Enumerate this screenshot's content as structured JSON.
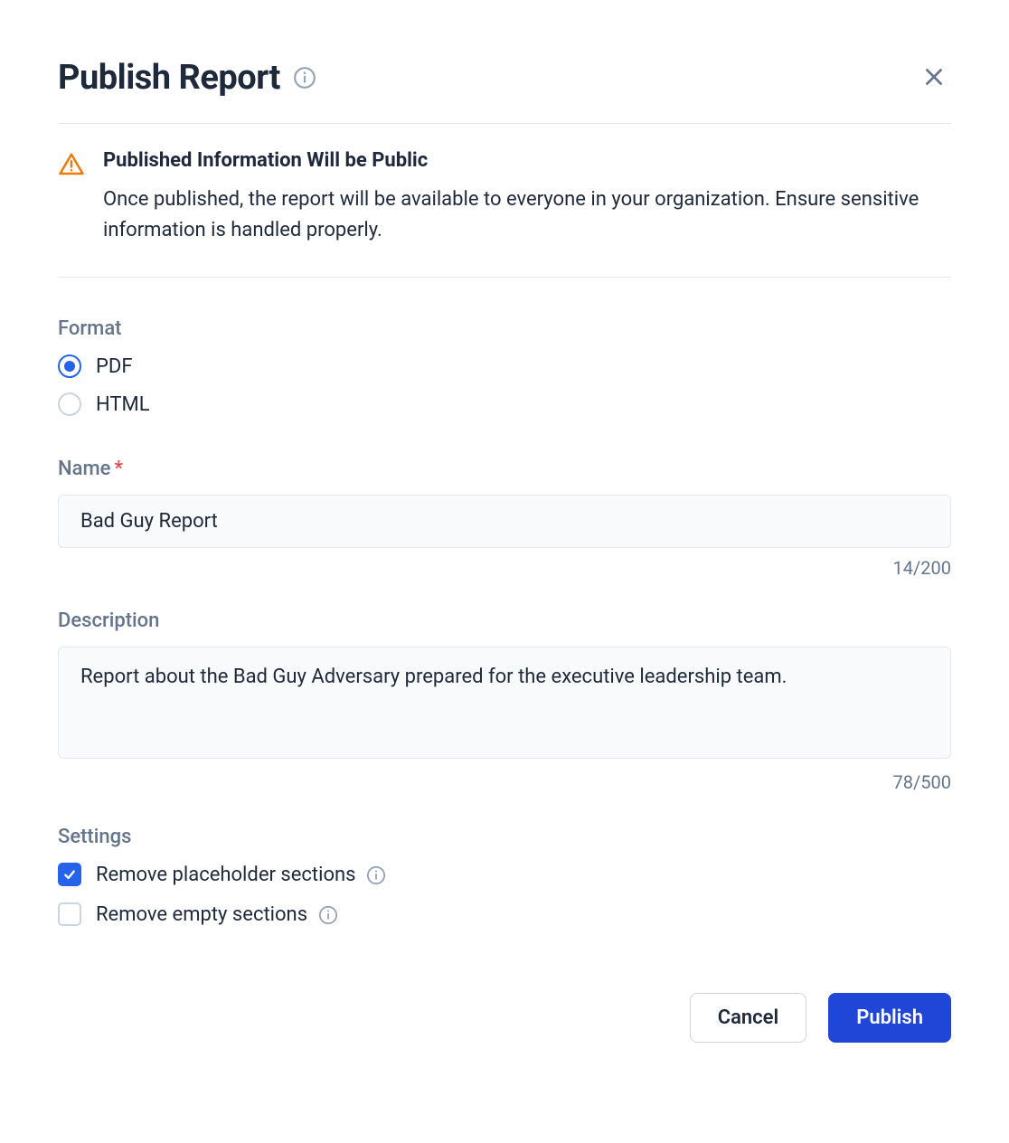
{
  "dialog": {
    "title": "Publish Report"
  },
  "warning": {
    "title": "Published Information Will be Public",
    "body": "Once published, the report will be available to everyone in your organization. Ensure sensitive information is handled properly."
  },
  "format": {
    "label": "Format",
    "options": [
      {
        "label": "PDF",
        "selected": true
      },
      {
        "label": "HTML",
        "selected": false
      }
    ]
  },
  "name": {
    "label": "Name",
    "required": true,
    "value": "Bad Guy Report",
    "counter": "14/200"
  },
  "description": {
    "label": "Description",
    "value": "Report about the Bad Guy Adversary prepared for the executive leadership team.",
    "counter": "78/500"
  },
  "settings": {
    "label": "Settings",
    "items": [
      {
        "label": "Remove placeholder sections",
        "checked": true
      },
      {
        "label": "Remove empty sections",
        "checked": false
      }
    ]
  },
  "footer": {
    "cancel": "Cancel",
    "publish": "Publish"
  }
}
